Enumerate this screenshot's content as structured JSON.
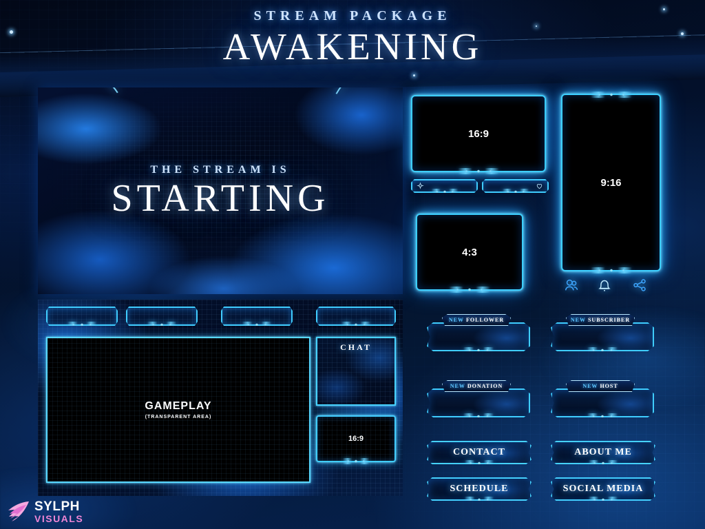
{
  "header": {
    "kicker": "STREAM PACKAGE",
    "title": "AWAKENING"
  },
  "starting_screen": {
    "kicker": "THE STREAM IS",
    "title": "STARTING"
  },
  "gameplay_overlay": {
    "tabs": [
      "",
      "",
      "",
      ""
    ],
    "gameplay_label": "GAMEPLAY",
    "gameplay_sublabel": "(TRANSPARENT AREA)",
    "chat_label": "CHAT",
    "webcam_label": "16:9"
  },
  "webcam_frames": [
    {
      "id": "cam-169",
      "label": "16:9"
    },
    {
      "id": "cam-916",
      "label": "9:16"
    },
    {
      "id": "cam-43",
      "label": "4:3"
    }
  ],
  "label_bars": [
    {
      "icon": "sparkle-icon",
      "label": ""
    },
    {
      "icon": "heart-icon",
      "label": ""
    }
  ],
  "social_icons": [
    {
      "name": "follow-icon"
    },
    {
      "name": "bell-icon"
    },
    {
      "name": "share-icon"
    }
  ],
  "alerts": [
    {
      "prefix": "NEW",
      "label": "FOLLOWER"
    },
    {
      "prefix": "NEW",
      "label": "SUBSCRIBER"
    },
    {
      "prefix": "NEW",
      "label": "DONATION"
    },
    {
      "prefix": "NEW",
      "label": "HOST"
    }
  ],
  "panel_buttons": [
    {
      "label": "CONTACT"
    },
    {
      "label": "ABOUT ME"
    },
    {
      "label": "SCHEDULE"
    },
    {
      "label": "SOCIAL MEDIA"
    }
  ],
  "logo": {
    "line1": "SYLPH",
    "line2": "VISUALS"
  },
  "colors": {
    "accent_cyan": "#3fcdff",
    "accent_glow": "#7fe4ff",
    "deep_blue": "#041631",
    "title_white": "#ffffff",
    "kicker_blue": "#cfe4ff",
    "logo_pink": "#ef86d6"
  }
}
